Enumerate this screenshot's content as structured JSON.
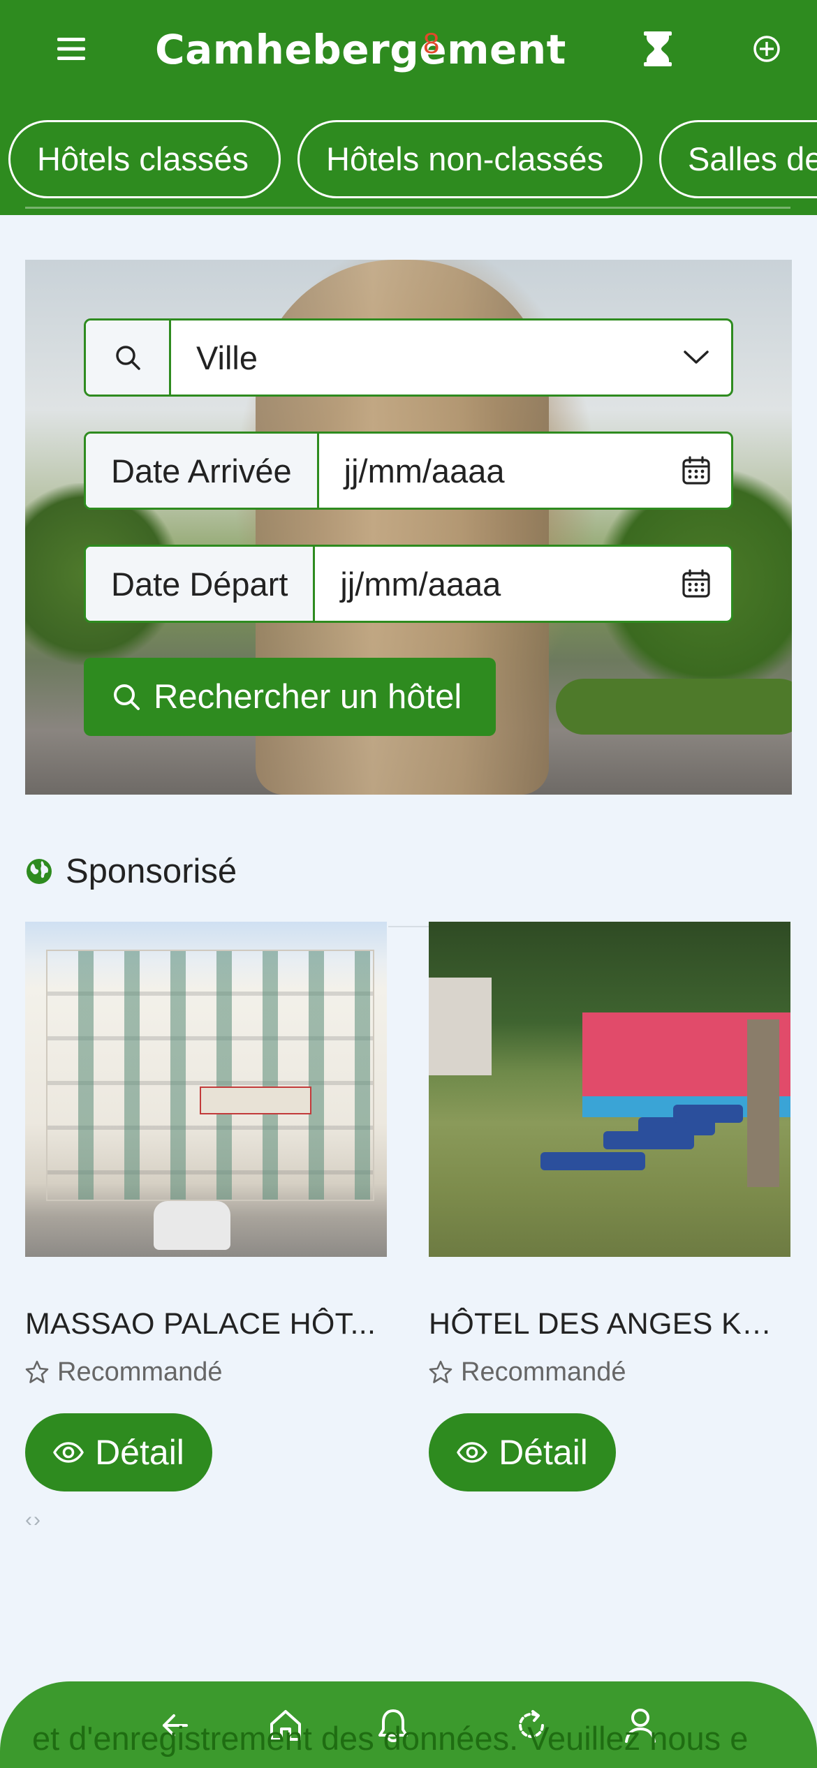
{
  "app": {
    "title": "Camhebergement"
  },
  "header": {
    "menu_icon": "hamburger-menu-icon",
    "history_icon": "hourglass-icon",
    "add_icon": "plus-circle-icon"
  },
  "categories": [
    {
      "label": "Hôtels classés"
    },
    {
      "label": "Hôtels non-classés"
    },
    {
      "label": "Salles de"
    }
  ],
  "search": {
    "city": {
      "value": "Ville",
      "icon": "search-icon",
      "dropdown_icon": "chevron-down-icon"
    },
    "arrival": {
      "label": "Date Arrivée",
      "placeholder": "jj/mm/aaaa",
      "icon": "calendar-icon"
    },
    "departure": {
      "label": "Date Départ",
      "placeholder": "jj/mm/aaaa",
      "icon": "calendar-icon"
    },
    "button_label": "Rechercher un hôtel"
  },
  "sponsored": {
    "heading": "Sponsorisé",
    "icon": "globe-icon",
    "hotels": [
      {
        "name": "MASSAO PALACE HÔT...",
        "badge": "Recommandé",
        "button_label": "Détail"
      },
      {
        "name": "HÔTEL DES ANGES KRI...",
        "badge": "Recommandé",
        "button_label": "Détail"
      }
    ],
    "nav": "‹›"
  },
  "footer": {
    "scrolling_text": "et d'enregistrement des données. Veuillez nous e",
    "notification_count": "8",
    "icons": [
      "arrow-left-icon",
      "home-icon",
      "bell-icon",
      "refresh-icon",
      "user-icon"
    ]
  },
  "colors": {
    "primary": "#2e8b1f",
    "background": "#eef4fb",
    "bottom_bar": "#3c9a2d",
    "badge": "#e04a2a"
  }
}
